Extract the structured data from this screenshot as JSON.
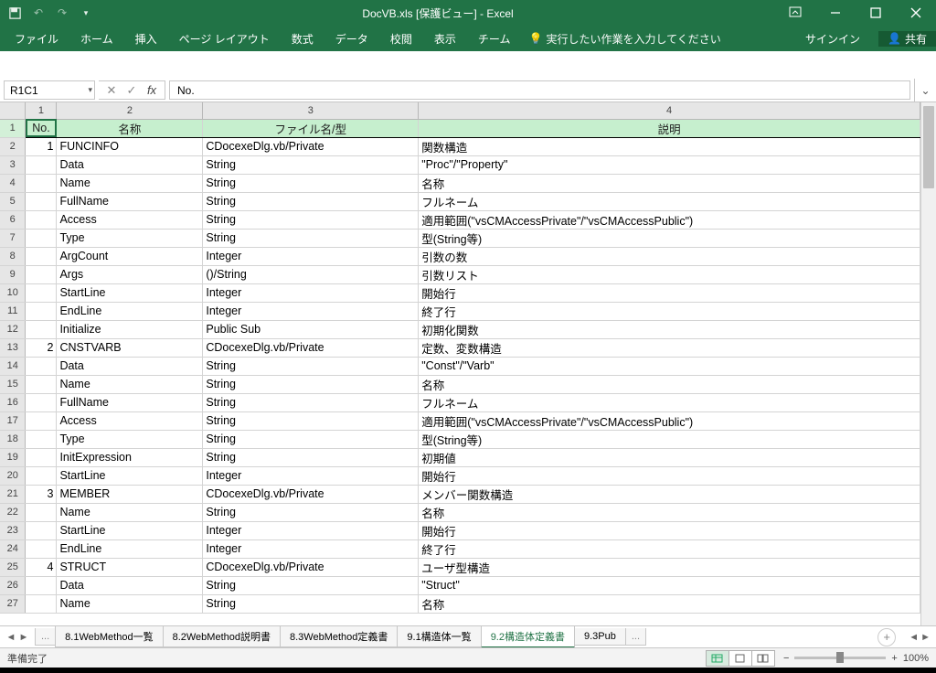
{
  "titlebar": {
    "title": "DocVB.xls  [保護ビュー] - Excel"
  },
  "ribbon": {
    "tabs": [
      "ファイル",
      "ホーム",
      "挿入",
      "ページ レイアウト",
      "数式",
      "データ",
      "校閲",
      "表示",
      "チーム"
    ],
    "tellme": "実行したい作業を入力してください",
    "signin": "サインイン",
    "share": "共有"
  },
  "formula": {
    "namebox": "R1C1",
    "fx": "fx",
    "value": "No."
  },
  "columns": {
    "nums": [
      "1",
      "2",
      "3",
      "4"
    ],
    "headers": [
      "No.",
      "名称",
      "ファイル名/型",
      "説明"
    ]
  },
  "rows": [
    {
      "no": "1",
      "name": "FUNCINFO",
      "type": "CDocexeDlg.vb/Private",
      "desc": "関数構造",
      "sect": true
    },
    {
      "no": "",
      "name": "Data",
      "type": "String",
      "desc": "\"Proc\"/\"Property\""
    },
    {
      "no": "",
      "name": "Name",
      "type": "String",
      "desc": "名称"
    },
    {
      "no": "",
      "name": "FullName",
      "type": "String",
      "desc": "フルネーム"
    },
    {
      "no": "",
      "name": "Access",
      "type": "String",
      "desc": "適用範囲(\"vsCMAccessPrivate\"/\"vsCMAccessPublic\")"
    },
    {
      "no": "",
      "name": "Type",
      "type": "String",
      "desc": "型(String等)"
    },
    {
      "no": "",
      "name": "ArgCount",
      "type": "Integer",
      "desc": "引数の数"
    },
    {
      "no": "",
      "name": "Args",
      "type": "()/String",
      "desc": "引数リスト"
    },
    {
      "no": "",
      "name": "StartLine",
      "type": "Integer",
      "desc": "開始行"
    },
    {
      "no": "",
      "name": "EndLine",
      "type": "Integer",
      "desc": "終了行"
    },
    {
      "no": "",
      "name": "Initialize",
      "type": "Public Sub",
      "desc": "初期化関数"
    },
    {
      "no": "2",
      "name": "CNSTVARB",
      "type": "CDocexeDlg.vb/Private",
      "desc": "定数、変数構造",
      "sect": true
    },
    {
      "no": "",
      "name": "Data",
      "type": "String",
      "desc": "\"Const\"/\"Varb\""
    },
    {
      "no": "",
      "name": "Name",
      "type": "String",
      "desc": "名称"
    },
    {
      "no": "",
      "name": "FullName",
      "type": "String",
      "desc": "フルネーム"
    },
    {
      "no": "",
      "name": "Access",
      "type": "String",
      "desc": "適用範囲(\"vsCMAccessPrivate\"/\"vsCMAccessPublic\")"
    },
    {
      "no": "",
      "name": "Type",
      "type": "String",
      "desc": "型(String等)"
    },
    {
      "no": "",
      "name": "InitExpression",
      "type": "String",
      "desc": "初期値"
    },
    {
      "no": "",
      "name": "StartLine",
      "type": "Integer",
      "desc": "開始行"
    },
    {
      "no": "3",
      "name": "MEMBER",
      "type": "CDocexeDlg.vb/Private",
      "desc": "メンバー関数構造",
      "sect": true
    },
    {
      "no": "",
      "name": "Name",
      "type": "String",
      "desc": "名称"
    },
    {
      "no": "",
      "name": "StartLine",
      "type": "Integer",
      "desc": "開始行"
    },
    {
      "no": "",
      "name": "EndLine",
      "type": "Integer",
      "desc": "終了行"
    },
    {
      "no": "4",
      "name": "STRUCT",
      "type": "CDocexeDlg.vb/Private",
      "desc": "ユーザ型構造",
      "sect": true
    },
    {
      "no": "",
      "name": "Data",
      "type": "String",
      "desc": "\"Struct\""
    },
    {
      "no": "",
      "name": "Name",
      "type": "String",
      "desc": "名称"
    }
  ],
  "sheets": {
    "ellipsis": "...",
    "tabs": [
      "8.1WebMethod一覧",
      "8.2WebMethod説明書",
      "8.3WebMethod定義書",
      "9.1構造体一覧",
      "9.2構造体定義書",
      "9.3Pub"
    ],
    "activeIndex": 4,
    "trailEll": "..."
  },
  "status": {
    "ready": "準備完了",
    "zoom": "100%"
  }
}
